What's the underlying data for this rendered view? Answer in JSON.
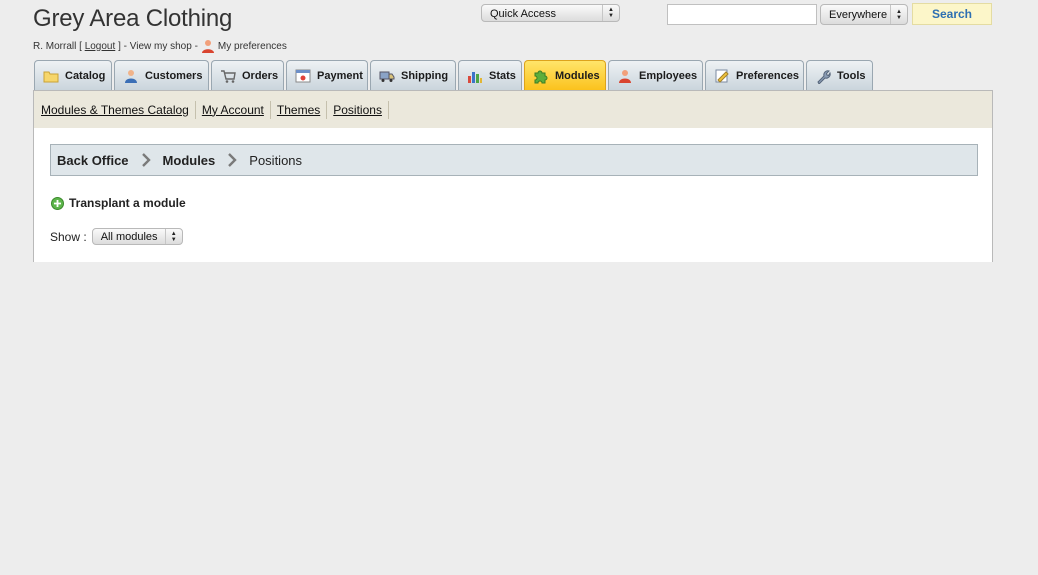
{
  "header": {
    "shop_title": "Grey Area Clothing",
    "user_name": "R. Morrall",
    "logout_prefix": "[",
    "logout_label": "Logout",
    "logout_suffix": "] - View my shop -",
    "preferences_label": "My preferences",
    "quick_access": "Quick Access",
    "search_value": "",
    "search_scope": "Everywhere",
    "search_button": "Search"
  },
  "tabs": [
    {
      "label": "Catalog",
      "icon": "folder-icon"
    },
    {
      "label": "Customers",
      "icon": "customer-icon"
    },
    {
      "label": "Orders",
      "icon": "cart-icon"
    },
    {
      "label": "Payment",
      "icon": "payment-icon"
    },
    {
      "label": "Shipping",
      "icon": "truck-icon"
    },
    {
      "label": "Stats",
      "icon": "chart-icon"
    },
    {
      "label": "Modules",
      "icon": "puzzle-icon",
      "active": true
    },
    {
      "label": "Employees",
      "icon": "employee-icon"
    },
    {
      "label": "Preferences",
      "icon": "preferences-icon"
    },
    {
      "label": "Tools",
      "icon": "wrench-icon"
    }
  ],
  "subnav": [
    "Modules & Themes Catalog",
    "My Account",
    "Themes",
    "Positions"
  ],
  "breadcrumb": [
    "Back Office",
    "Modules",
    "Positions"
  ],
  "main": {
    "transplant_label": "Transplant a module",
    "show_label": "Show :",
    "show_value": "All modules"
  },
  "colors": {
    "active_tab": "#fbc21d",
    "search_button_text": "#2d6fb2",
    "breadcrumb_bg": "#dfe6ea"
  }
}
